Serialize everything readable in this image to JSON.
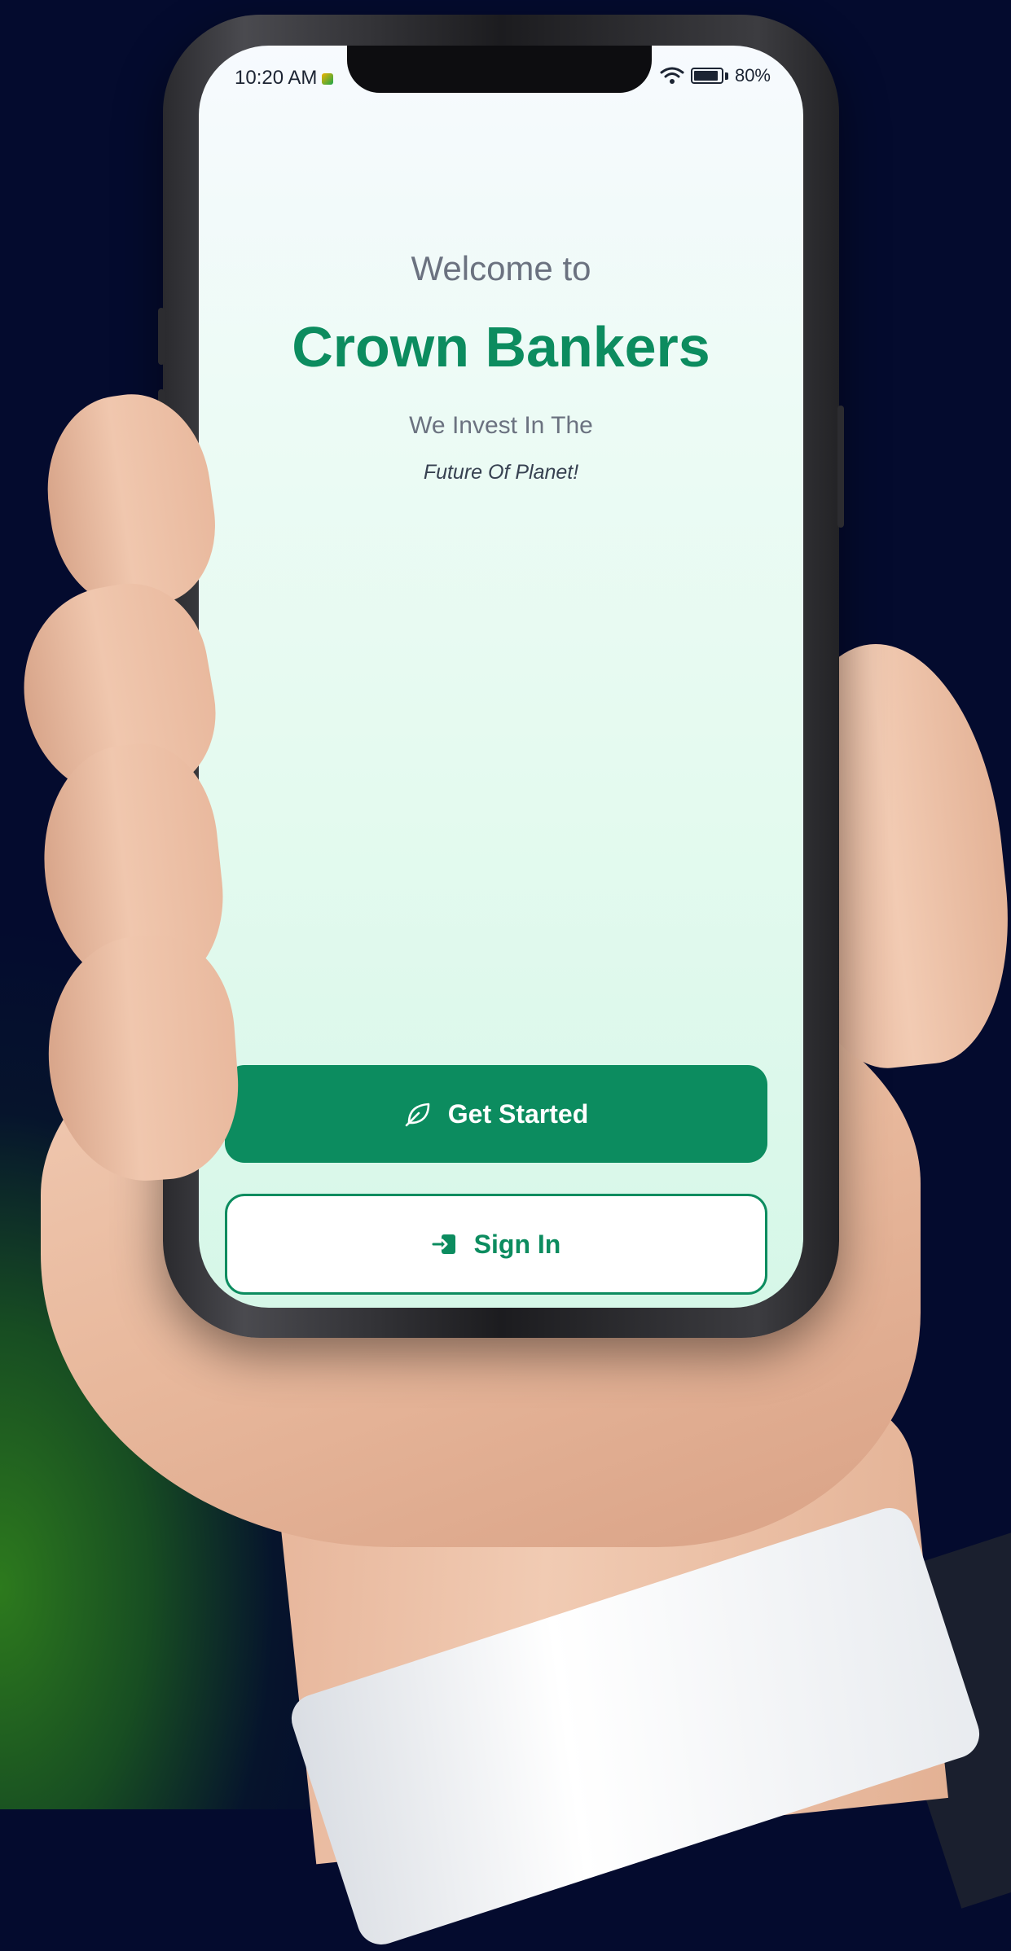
{
  "status_bar": {
    "time": "10:20 AM",
    "battery": "80%"
  },
  "welcome": {
    "greeting": "Welcome to",
    "brand": "Crown Bankers",
    "tagline_line1": "We Invest In The",
    "tagline_line2": "Future Of Planet!"
  },
  "actions": {
    "get_started_label": "Get Started",
    "sign_in_label": "Sign In"
  },
  "colors": {
    "brand_green": "#0c8c5f",
    "page_background": "#040b2e"
  },
  "icons": {
    "get_started": "leaf-icon",
    "sign_in": "sign-in-icon",
    "wifi": "wifi-icon",
    "battery": "battery-icon"
  }
}
